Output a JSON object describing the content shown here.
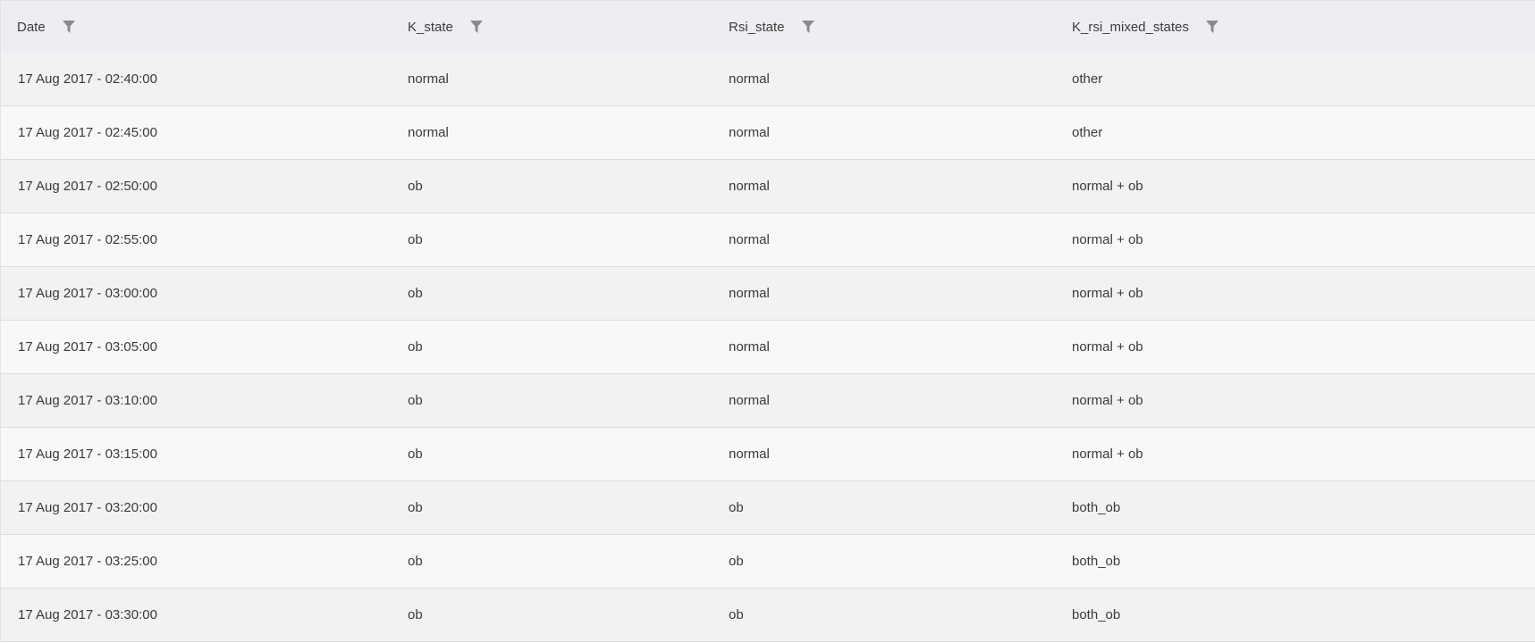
{
  "table": {
    "columns": [
      {
        "label": "Date",
        "filter_icon": "filter-icon"
      },
      {
        "label": "K_state",
        "filter_icon": "filter-icon"
      },
      {
        "label": "Rsi_state",
        "filter_icon": "filter-icon"
      },
      {
        "label": "K_rsi_mixed_states",
        "filter_icon": "filter-icon"
      }
    ],
    "rows": [
      [
        "17 Aug 2017 - 02:40:00",
        "normal",
        "normal",
        "other"
      ],
      [
        "17 Aug 2017 - 02:45:00",
        "normal",
        "normal",
        "other"
      ],
      [
        "17 Aug 2017 - 02:50:00",
        "ob",
        "normal",
        "normal + ob"
      ],
      [
        "17 Aug 2017 - 02:55:00",
        "ob",
        "normal",
        "normal + ob"
      ],
      [
        "17 Aug 2017 - 03:00:00",
        "ob",
        "normal",
        "normal + ob"
      ],
      [
        "17 Aug 2017 - 03:05:00",
        "ob",
        "normal",
        "normal + ob"
      ],
      [
        "17 Aug 2017 - 03:10:00",
        "ob",
        "normal",
        "normal + ob"
      ],
      [
        "17 Aug 2017 - 03:15:00",
        "ob",
        "normal",
        "normal + ob"
      ],
      [
        "17 Aug 2017 - 03:20:00",
        "ob",
        "ob",
        "both_ob"
      ],
      [
        "17 Aug 2017 - 03:25:00",
        "ob",
        "ob",
        "both_ob"
      ],
      [
        "17 Aug 2017 - 03:30:00",
        "ob",
        "ob",
        "both_ob"
      ]
    ]
  },
  "colors": {
    "header_bg": "#eceef1",
    "row_odd_bg": "#f1f2f4",
    "row_even_bg": "#f8f8f8",
    "icon": "#8a8a8a",
    "text": "#3a3a3a"
  }
}
